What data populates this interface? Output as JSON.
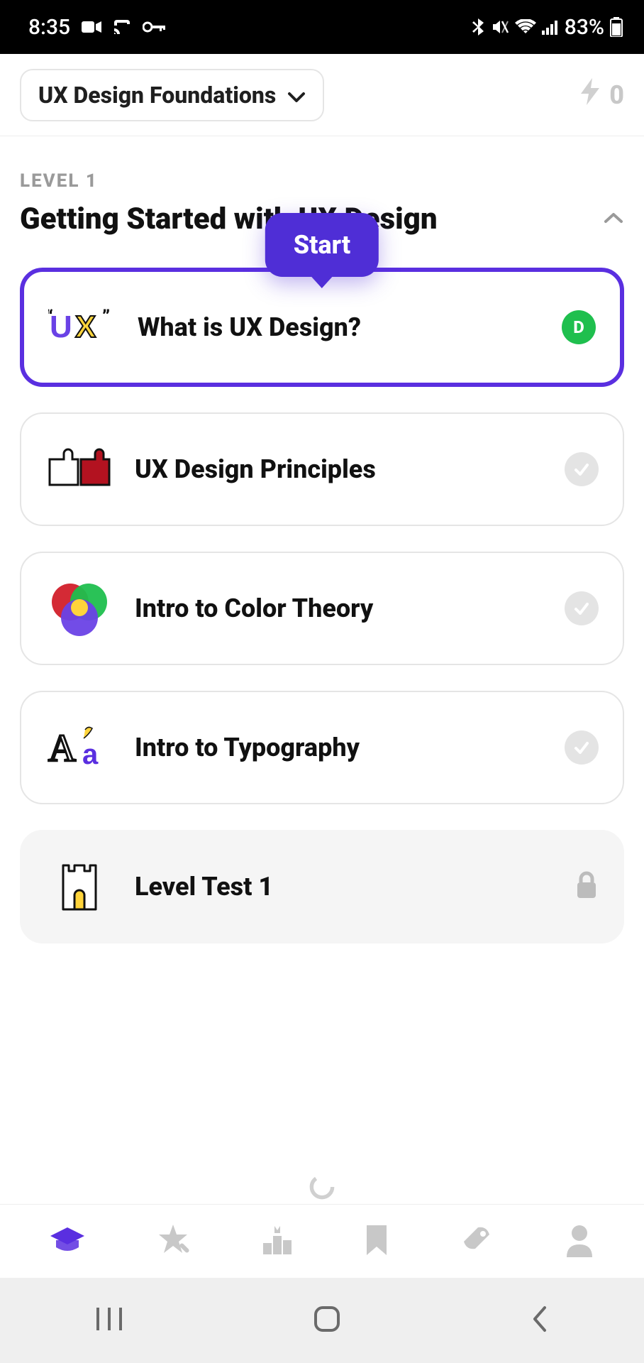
{
  "status_bar": {
    "time": "8:35",
    "battery_text": "83%"
  },
  "header": {
    "course_title": "UX Design Foundations",
    "streak_count": "0"
  },
  "level": {
    "label": "LEVEL 1",
    "title": "Getting Started with UX Design"
  },
  "tooltip": {
    "start_label": "Start"
  },
  "lessons": [
    {
      "title": "What is UX Design?",
      "badge": "D"
    },
    {
      "title": "UX Design Principles"
    },
    {
      "title": "Intro to Color Theory"
    },
    {
      "title": "Intro to Typography"
    },
    {
      "title": "Level Test 1"
    }
  ]
}
